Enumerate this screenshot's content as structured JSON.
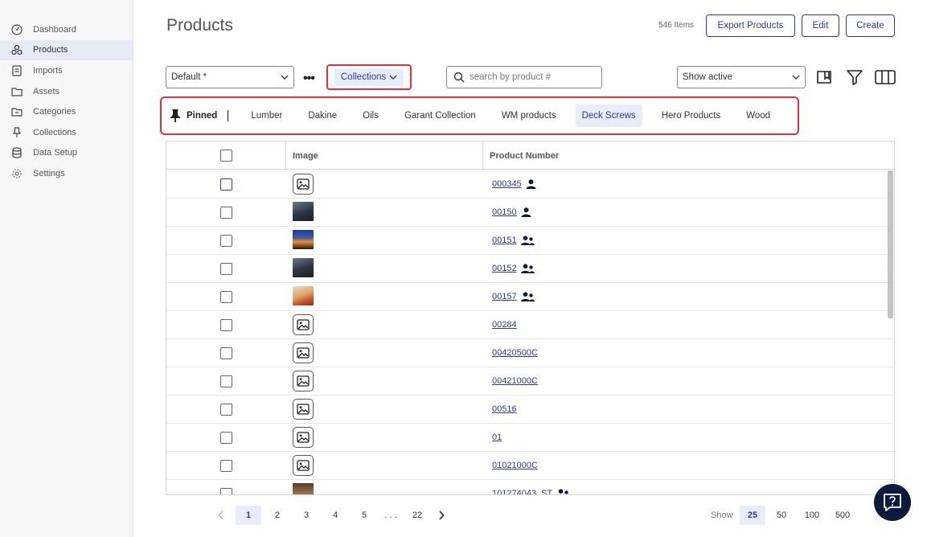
{
  "sidebar": {
    "items": [
      {
        "label": "Dashboard",
        "icon": "dashboard-icon"
      },
      {
        "label": "Products",
        "icon": "products-icon",
        "active": true
      },
      {
        "label": "Imports",
        "icon": "imports-icon"
      },
      {
        "label": "Assets",
        "icon": "folder-icon"
      },
      {
        "label": "Categories",
        "icon": "categories-icon"
      },
      {
        "label": "Collections",
        "icon": "pin-icon"
      },
      {
        "label": "Data Setup",
        "icon": "database-icon"
      },
      {
        "label": "Settings",
        "icon": "gear-icon"
      }
    ]
  },
  "header": {
    "title": "Products",
    "count": "546 Items",
    "export_label": "Export Products",
    "edit_label": "Edit",
    "create_label": "Create"
  },
  "toolbar": {
    "view_select": "Default *",
    "collections_label": "Collections",
    "search_placeholder": "search by product #",
    "status_select": "Show active"
  },
  "collections": {
    "pinned_label": "Pinned",
    "items": [
      "Lumber",
      "Dakine",
      "Oils",
      "Garant Collection",
      "WM products",
      "Deck Screws",
      "Hero Products",
      "Wood"
    ],
    "active": "Deck Screws"
  },
  "table": {
    "headers": {
      "image": "Image",
      "product_number": "Product Number"
    },
    "rows": [
      {
        "pn": "000345",
        "image": "placeholder",
        "owner": "single"
      },
      {
        "pn": "00150",
        "image": "photo-dark",
        "owner": "single"
      },
      {
        "pn": "00151",
        "image": "photo-sunset",
        "owner": "group"
      },
      {
        "pn": "00152",
        "image": "photo-dark",
        "owner": "group"
      },
      {
        "pn": "00157",
        "image": "photo-warm",
        "owner": "group"
      },
      {
        "pn": "00284",
        "image": "placeholder",
        "owner": "none"
      },
      {
        "pn": "00420500C",
        "image": "placeholder",
        "owner": "none"
      },
      {
        "pn": "00421000C",
        "image": "placeholder",
        "owner": "none"
      },
      {
        "pn": "00516",
        "image": "placeholder",
        "owner": "none"
      },
      {
        "pn": "01",
        "image": "placeholder",
        "owner": "none"
      },
      {
        "pn": "01021000C",
        "image": "placeholder",
        "owner": "none"
      },
      {
        "pn": "101274043_ST",
        "image": "photo-brown",
        "owner": "group"
      }
    ]
  },
  "pagination": {
    "pages": [
      "1",
      "2",
      "3",
      "4",
      "5"
    ],
    "ellipsis": ". . .",
    "last": "22",
    "current": "1",
    "show_label": "Show",
    "page_sizes": [
      "25",
      "50",
      "100",
      "500"
    ],
    "page_size": "25"
  },
  "colors": {
    "accent": "#2f3a9c",
    "highlight": "#e0303a",
    "active_bg": "#e8ecfb",
    "help_bg": "#0b1a3d"
  }
}
